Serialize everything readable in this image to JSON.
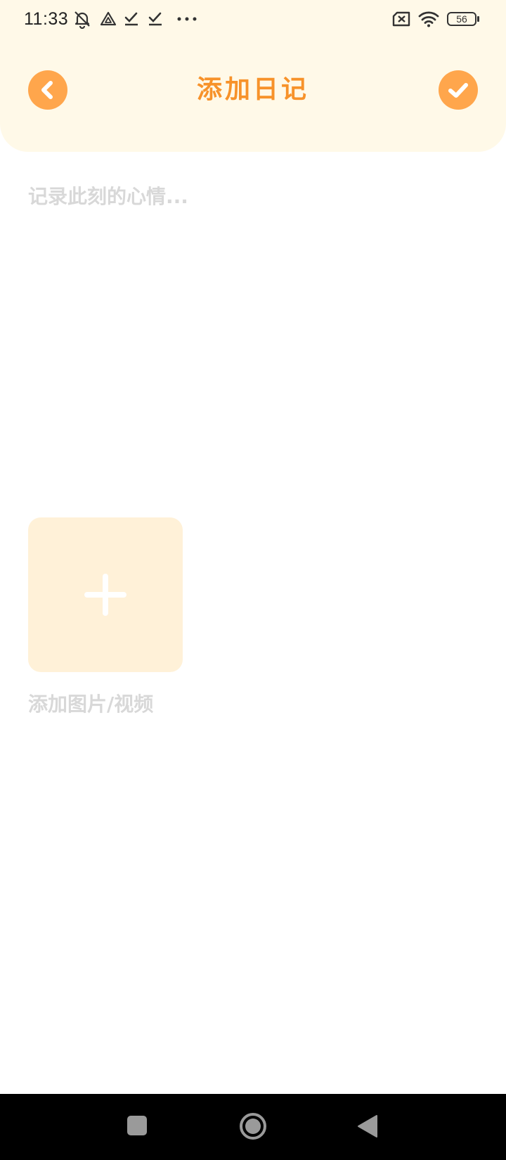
{
  "status_bar": {
    "time": "11:33",
    "battery_level": "56",
    "icons": [
      "muted-alarm-icon",
      "drive-icon",
      "check-icon",
      "check-icon",
      "more-dots-icon",
      "no-sim-icon",
      "wifi-icon",
      "battery-icon"
    ]
  },
  "header": {
    "title": "添加日记",
    "back_icon": "chevron-left-icon",
    "confirm_icon": "check-icon"
  },
  "editor": {
    "placeholder": "记录此刻的心情...",
    "value": ""
  },
  "media": {
    "add_icon": "plus-icon",
    "label": "添加图片/视频"
  },
  "system_nav": {
    "icons": [
      "recents-icon",
      "home-icon",
      "back-icon"
    ]
  },
  "colors": {
    "header_bg": "#FFF9E8",
    "accent": "#FFA64C",
    "title": "#F7922A",
    "placeholder": "#D8D8D8",
    "media_tile": "#FFF1D8"
  }
}
